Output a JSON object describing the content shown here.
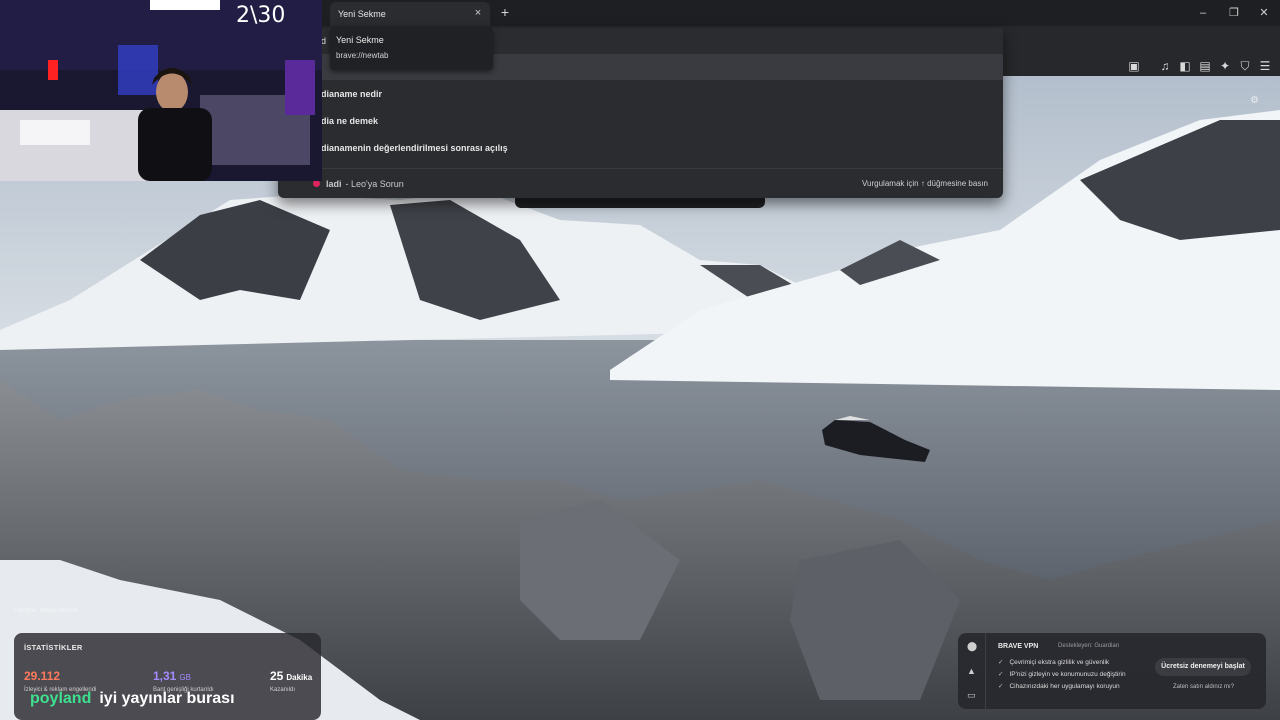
{
  "browser": {
    "tab": {
      "title": "Yeni Sekme",
      "close": "×"
    },
    "new_tab": "+",
    "window": {
      "minimize": "–",
      "maximize": "❐",
      "close": "✕"
    },
    "tooltip": {
      "title": "Yeni Sekme",
      "url": "brave://newtab"
    }
  },
  "omnibox": {
    "typed": "d",
    "suggestions": [
      {
        "text": "dianame nedir"
      },
      {
        "text": "dia ne demek"
      },
      {
        "text": "dianamenin değerlendirilmesi sonrası açılış"
      }
    ],
    "leo_query": "ladi",
    "leo_label": "- Leo'ya Sorun",
    "hint": "Vurgulamak için ↑ düğmesine basın"
  },
  "webcam": {
    "counter": "2\\30"
  },
  "newtab": {
    "photo_credit": "Fotoğraf: Megan Mulhol...",
    "stats": {
      "title": "İSTATİSTİKLER",
      "items": [
        {
          "value": "29.112",
          "unit": "",
          "label": "İzleyici & reklam engellendi",
          "color": "#ff7a5c"
        },
        {
          "value": "1,31",
          "unit": "GB",
          "label": "Bant genişliği kurtarıldı",
          "color": "#a48bff"
        },
        {
          "value": "25",
          "unit": "Dakika",
          "label": "Kazanıldı",
          "color": "#ffffff"
        }
      ]
    },
    "stream_overlay": {
      "name": "poyland",
      "text": "iyi yayınlar burası"
    },
    "vpn": {
      "title": "BRAVE VPN",
      "sponsor": "Destekleyen: Guardian",
      "features": [
        "Çevrimiçi ekstra gizlilik ve güvenlik",
        "IP'nizi gizleyin ve konumunuzu değiştirin",
        "Cihazınızdaki her uygulamayı koruyun"
      ],
      "cta": "Ücretsiz denemeyi başlat",
      "link": "Zaten satın aldınız mı?"
    }
  }
}
